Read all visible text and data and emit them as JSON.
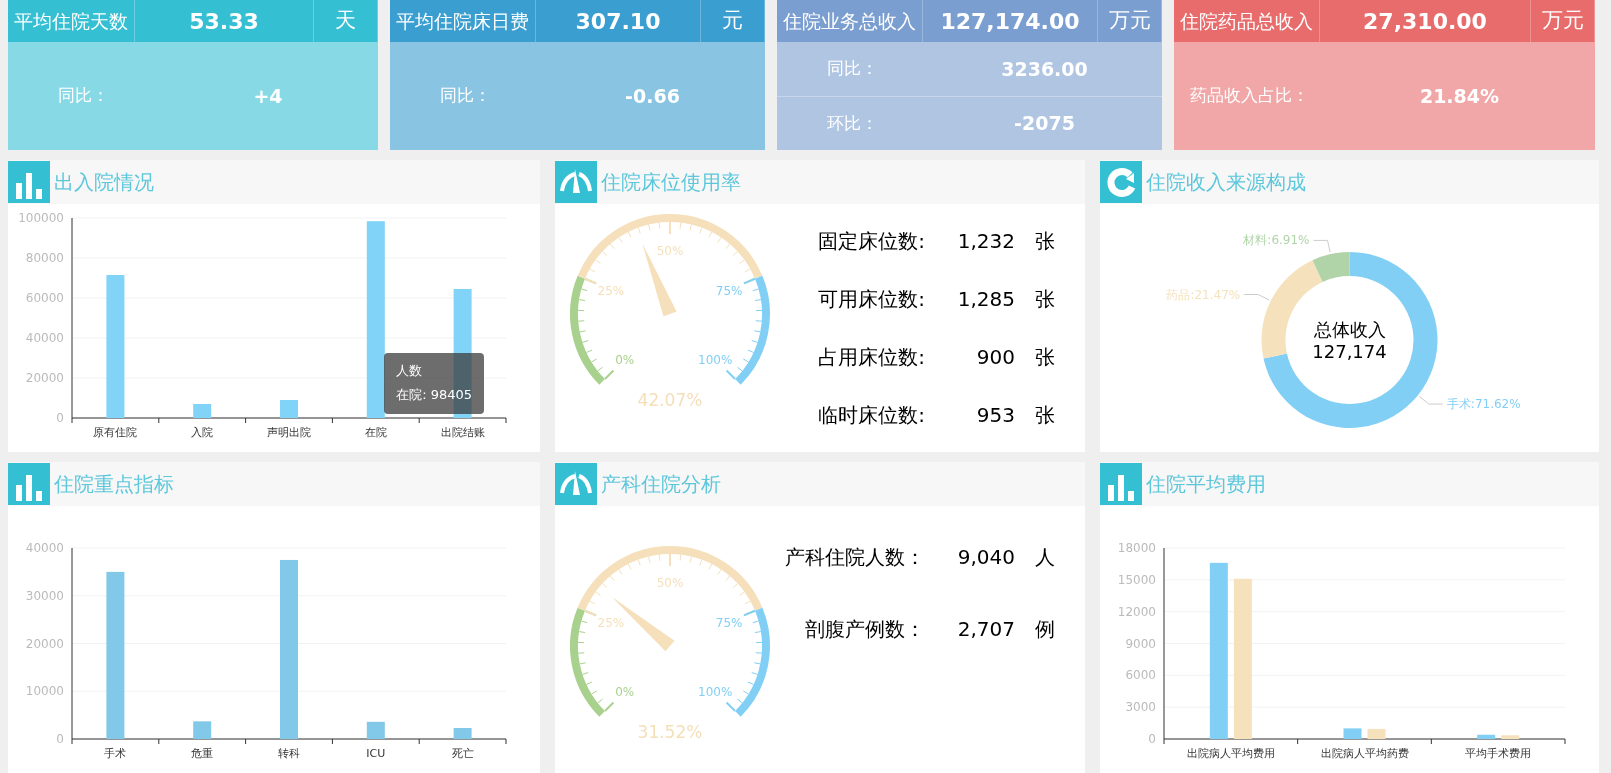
{
  "kpis": [
    {
      "title": "平均住院天数",
      "value": "53.33",
      "unit": "天",
      "color": "#35bfd3",
      "rows": [
        {
          "label": "同比：",
          "value": "+4"
        }
      ]
    },
    {
      "title": "平均住院床日费",
      "value": "307.10",
      "unit": "元",
      "color": "#3a9fd0",
      "rows": [
        {
          "label": "同比：",
          "value": "-0.66"
        }
      ]
    },
    {
      "title": "住院业务总收入",
      "value": "127,174.00",
      "unit": "万元",
      "color": "#7a9ecf",
      "rows": [
        {
          "label": "同比：",
          "value": "3236.00"
        },
        {
          "label": "环比：",
          "value": "-2075"
        }
      ]
    },
    {
      "title": "住院药品总收入",
      "value": "27,310.00",
      "unit": "万元",
      "color": "#e86c6c",
      "rows": [
        {
          "label": "药品收入占比：",
          "value": "21.84%"
        }
      ]
    }
  ],
  "panels": [
    {
      "title": "出入院情况",
      "kind": "bar",
      "chart_data": {
        "type": "bar",
        "grid": true,
        "categories": [
          "原有住院",
          "入院",
          "声明出院",
          "在院",
          "出院结账"
        ],
        "series": [
          {
            "color": "#81d3f8",
            "values": [
              71500,
              7000,
              9000,
              98405,
              64500
            ]
          }
        ],
        "ylim": [
          0,
          100000
        ],
        "yticks": [
          0,
          20000,
          40000,
          60000,
          80000,
          100000
        ]
      },
      "tooltip": {
        "title": "人数",
        "text": "在院: 98405"
      }
    },
    {
      "title": "住院床位使用率",
      "kind": "gauge",
      "gauge": {
        "level": 0.4207,
        "reading": "42.07%",
        "ticks": [
          "0%",
          "25%",
          "50%",
          "75%",
          "100%"
        ]
      },
      "stats": [
        {
          "label": "固定床位数:",
          "value": "1,232",
          "unit": "张"
        },
        {
          "label": "可用床位数:",
          "value": "1,285",
          "unit": "张"
        },
        {
          "label": "占用床位数:",
          "value": "900",
          "unit": "张"
        },
        {
          "label": "临时床位数:",
          "value": "953",
          "unit": "张"
        }
      ]
    },
    {
      "title": "住院收入来源构成",
      "kind": "donut",
      "chart_data": {
        "type": "donut",
        "series": [
          {
            "values": [
              71.62,
              21.47,
              6.91
            ]
          }
        ],
        "colors": [
          "#81cff4",
          "#f5e2bd",
          "#b0d4a8"
        ],
        "value_labels": [
          "手术:71.62%",
          "药品:21.47%",
          "材料:6.91%"
        ]
      },
      "center": [
        "总体收入",
        "127,174"
      ]
    },
    {
      "title": "住院重点指标",
      "kind": "bar",
      "chart_data": {
        "type": "bar",
        "grid": true,
        "categories": [
          "手术",
          "危重",
          "转科",
          "ICU",
          "死亡"
        ],
        "series": [
          {
            "color": "#82c8e8",
            "values": [
              35000,
              3700,
              37500,
              3600,
              2300
            ]
          }
        ],
        "ylim": [
          0,
          40000
        ],
        "yticks": [
          0,
          10000,
          20000,
          30000,
          40000
        ]
      }
    },
    {
      "title": "产科住院分析",
      "kind": "gauge",
      "gauge": {
        "level": 0.3152,
        "reading": "31.52%",
        "ticks": [
          "0%",
          "25%",
          "50%",
          "75%",
          "100%"
        ]
      },
      "stats": [
        {
          "label": "产科住院人数：",
          "value": "9,040",
          "unit": "人"
        },
        {
          "label": "剖腹产例数：",
          "value": "2,707",
          "unit": "例"
        }
      ]
    },
    {
      "title": "住院平均费用",
      "kind": "bar",
      "chart_data": {
        "type": "bar",
        "grid": true,
        "categories": [
          "出院病人平均费用",
          "出院病人平均药费",
          "平均手术费用"
        ],
        "series": [
          {
            "color": "#81cff4",
            "values": [
              16600,
              1000,
              400
            ]
          },
          {
            "color": "#f5e2bd",
            "values": [
              15100,
              950,
              350
            ]
          }
        ],
        "ylim": [
          0,
          18000
        ],
        "yticks": [
          0,
          3000,
          6000,
          9000,
          12000,
          15000,
          18000
        ]
      }
    }
  ]
}
